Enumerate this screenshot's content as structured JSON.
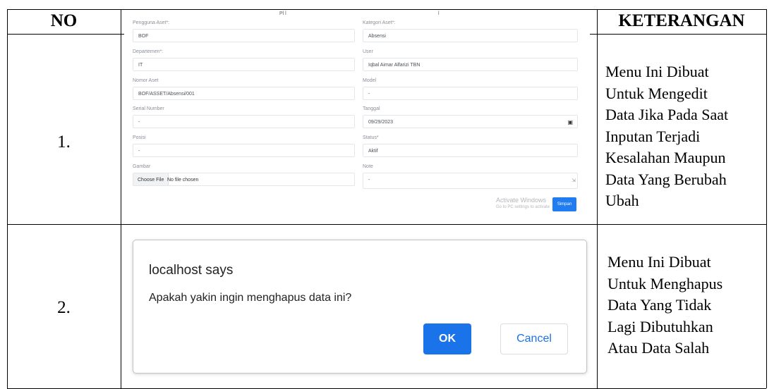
{
  "table": {
    "header": {
      "no": "NO",
      "keterangan": "KETERANGAN"
    },
    "rows": [
      {
        "no": "1.",
        "keterangan": [
          "Menu Ini Dibuat",
          "Untuk Mengedit",
          "Data Jika Pada Saat",
          "Inputan Terjadi",
          "Kesalahan Maupun",
          "Data Yang Berubah",
          "Ubah"
        ]
      },
      {
        "no": "2.",
        "keterangan": [
          "Menu Ini Dibuat",
          "Untuk Menghapus",
          "Data Yang Tidak",
          "Lagi Dibutuhkan",
          "Atau Data Salah"
        ]
      }
    ]
  },
  "edit_form": {
    "top_cut_left": "Pl l",
    "top_cut_right": "l",
    "fields": {
      "pengguna_aset": {
        "label": "Pengguna Aset*:",
        "value": "BOF"
      },
      "kategori_aset": {
        "label": "Kategori Aset*:",
        "value": "Absensi"
      },
      "departemen": {
        "label": "Departemen*:",
        "value": "IT"
      },
      "user": {
        "label": "User",
        "value": "Iqbal Aimar Alfarizi TBN"
      },
      "nomor_aset": {
        "label": "Nomor Aset",
        "value": "BOF/ASSET/Absensi/001"
      },
      "model": {
        "label": "Model",
        "value": "-"
      },
      "serial_number": {
        "label": "Serial Number",
        "value": "-"
      },
      "tanggal": {
        "label": "Tanggal",
        "value": "09/29/2023"
      },
      "posisi": {
        "label": "Posisi",
        "value": "-"
      },
      "status": {
        "label": "Status*",
        "value": "Aktif"
      },
      "gambar": {
        "label": "Gambar",
        "button": "Choose File",
        "file_text": "No file chosen"
      },
      "note": {
        "label": "Note",
        "value": "-"
      }
    },
    "watermark_line1": "Activate Windows",
    "watermark_line2": "Go to PC settings to activate",
    "simpan_label": "Simpan"
  },
  "confirm_dialog": {
    "title": "localhost says",
    "message": "Apakah yakin ingin menghapus data ini?",
    "ok_label": "OK",
    "cancel_label": "Cancel"
  }
}
